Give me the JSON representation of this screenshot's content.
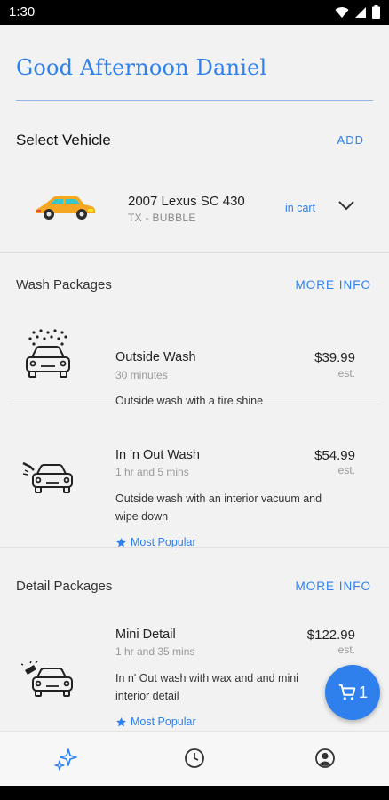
{
  "status_bar": {
    "time": "1:30"
  },
  "greeting": "Good Afternoon Daniel",
  "vehicle_section": {
    "title": "Select Vehicle",
    "add_label": "ADD"
  },
  "vehicle": {
    "name": "2007 Lexus SC 430",
    "plate": "TX - BUBBLE",
    "cart_status": "in cart"
  },
  "wash_section": {
    "title": "Wash Packages",
    "more_label": "MORE INFO"
  },
  "wash_packages": [
    {
      "name": "Outside Wash",
      "duration": "30 minutes",
      "price": "$39.99",
      "est": "est.",
      "description": "Outside wash with a tire shine"
    },
    {
      "name": "In 'n Out Wash",
      "duration": "1 hr and 5 mins",
      "price": "$54.99",
      "est": "est.",
      "description": "Outside wash with an interior vacuum and wipe down",
      "badge": "Most Popular"
    }
  ],
  "detail_section": {
    "title": "Detail Packages",
    "more_label": "MORE INFO"
  },
  "detail_packages": [
    {
      "name": "Mini Detail",
      "duration": "1 hr and 35 mins",
      "price": "$122.99",
      "est": "est.",
      "description": "In n' Out wash with wax and and mini interior detail",
      "badge": "Most Popular"
    }
  ],
  "cart_fab": {
    "count": "1"
  },
  "bottom_nav": [
    "sparkle-icon",
    "history-icon",
    "account-icon"
  ],
  "colors": {
    "accent": "#2f80ed",
    "background": "#f2f2f2"
  }
}
